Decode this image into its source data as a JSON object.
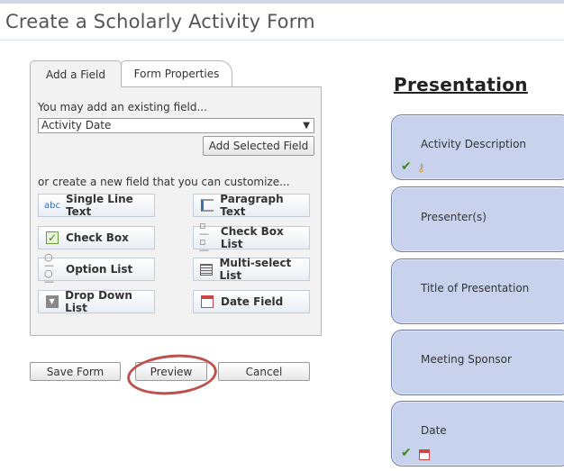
{
  "page": {
    "title": "Create a Scholarly Activity Form"
  },
  "tabs": [
    {
      "label": "Add a Field",
      "active": true
    },
    {
      "label": "Form Properties",
      "active": false
    }
  ],
  "panel": {
    "existing_label": "You may add an existing field...",
    "select_value": "Activity Date",
    "add_selected_label": "Add Selected Field",
    "new_label": "or create a new field that you can customize...",
    "field_buttons": [
      {
        "label": "Single Line Text",
        "icon": "abc-icon"
      },
      {
        "label": "Paragraph Text",
        "icon": "paragraph-icon"
      },
      {
        "label": "Check Box",
        "icon": "checkbox-icon"
      },
      {
        "label": "Check Box List",
        "icon": "checkbox-list-icon"
      },
      {
        "label": "Option List",
        "icon": "option-list-icon"
      },
      {
        "label": "Multi-select List",
        "icon": "multiselect-icon"
      },
      {
        "label": "Drop Down List",
        "icon": "dropdown-icon"
      },
      {
        "label": "Date Field",
        "icon": "calendar-icon"
      }
    ],
    "abc_text": "abc"
  },
  "actions": {
    "save_label": "Save Form",
    "preview_label": "Preview",
    "cancel_label": "Cancel",
    "highlight_color": "#c0504d"
  },
  "preview": {
    "heading": "Presentation",
    "cards": [
      {
        "label": "Activity Description",
        "required": true,
        "key": true
      },
      {
        "label": "Presenter(s)"
      },
      {
        "label": "Title of Presentation"
      },
      {
        "label": "Meeting Sponsor"
      },
      {
        "label": "Date",
        "required": true,
        "calendar": true
      }
    ],
    "card_color": "#c8d2ec"
  }
}
